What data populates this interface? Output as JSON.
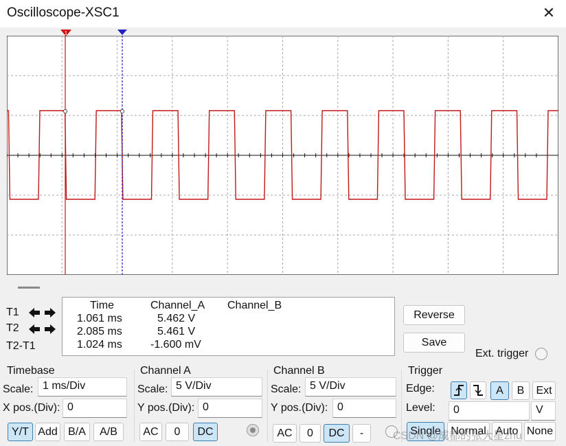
{
  "window": {
    "title": "Oscilloscope-XSC1",
    "close_glyph": "✕"
  },
  "cursors": {
    "t1_marker": "1",
    "t2_marker": "2"
  },
  "readout": {
    "col_time": "Time",
    "col_a": "Channel_A",
    "col_b": "Channel_B",
    "rows": [
      {
        "label": "T1",
        "time": "1.061 ms",
        "a": "5.462 V",
        "b": ""
      },
      {
        "label": "T2",
        "time": "2.085 ms",
        "a": "5.461 V",
        "b": ""
      },
      {
        "label": "T2-T1",
        "time": "1.024 ms",
        "a": "-1.600 mV",
        "b": ""
      }
    ]
  },
  "buttons": {
    "reverse": "Reverse",
    "save": "Save",
    "ext_trigger": "Ext. trigger"
  },
  "timebase": {
    "title": "Timebase",
    "scale_label": "Scale:",
    "scale": "1 ms/Div",
    "xpos_label": "X pos.(Div):",
    "xpos": "0",
    "modes": [
      "Y/T",
      "Add",
      "B/A",
      "A/B"
    ]
  },
  "channel_a": {
    "title": "Channel A",
    "scale_label": "Scale:",
    "scale": "5  V/Div",
    "ypos_label": "Y pos.(Div):",
    "ypos": "0",
    "coupling": [
      "AC",
      "0",
      "DC"
    ]
  },
  "channel_b": {
    "title": "Channel B",
    "scale_label": "Scale:",
    "scale": "5  V/Div",
    "ypos_label": "Y pos.(Div):",
    "ypos": "0",
    "coupling": [
      "AC",
      "0",
      "DC",
      "-"
    ]
  },
  "trigger": {
    "title": "Trigger",
    "edge_label": "Edge:",
    "sources": [
      "A",
      "B",
      "Ext"
    ],
    "level_label": "Level:",
    "level": "0",
    "level_unit": "V",
    "modes": [
      "Single",
      "Normal",
      "Auto",
      "None"
    ]
  },
  "watermark": "CSDN @成都的张大星zhu",
  "colors": {
    "trace": "#c01818",
    "t1_cursor": "#d01010",
    "t2_cursor": "#2020c0",
    "selected": "#cde6f7"
  }
}
